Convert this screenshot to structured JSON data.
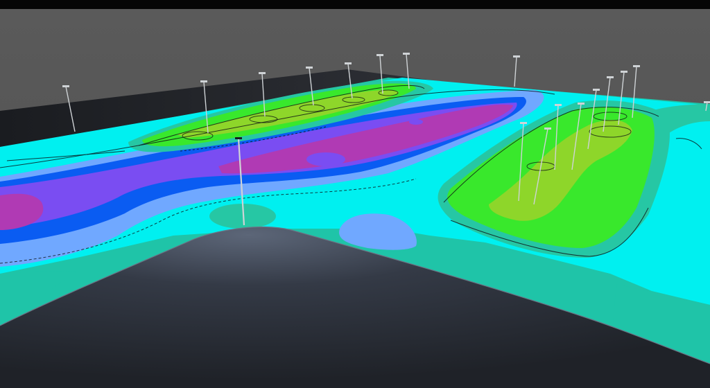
{
  "scene": {
    "type": "3d-lighting-isoline-rendering",
    "subject": "parking-lot-illuminance-false-color",
    "colors": {
      "top_bar": "#060606",
      "sky": "#5b5b5b",
      "ground_dark": "#222428",
      "building_roof": "#2c3038",
      "ground_base": "#1fc4a8",
      "level_cyan": "#00f0f0",
      "level_light_blue": "#70a8ff",
      "level_blue": "#0a5cf2",
      "level_violet": "#7a4df2",
      "level_magenta": "#b03ab4",
      "level_green": "#39e82c",
      "level_light_green": "#8ed62a",
      "level_teal": "#26c7a4",
      "pole_color": "#cfd3d6",
      "outline_color": "#0b0f14"
    },
    "icons": [
      "light-pole-icon"
    ]
  }
}
